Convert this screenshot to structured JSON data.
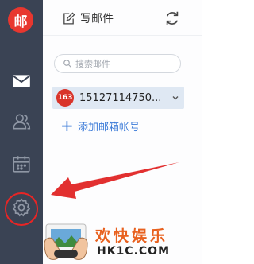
{
  "sidebar": {
    "logo_text": "邮",
    "icons": [
      "mail-icon",
      "contacts-icon",
      "calendar-icon",
      "settings-icon"
    ],
    "accent_color": "#e8372f",
    "background_color": "#3a4354"
  },
  "toolbar": {
    "compose_label": "写邮件",
    "refresh_icon": "refresh-icon"
  },
  "search": {
    "placeholder": "搜索邮件"
  },
  "account": {
    "badge": "163",
    "address": "15127114750...",
    "badge_color": "#d9342a"
  },
  "add_account": {
    "label": "添加邮箱帐号",
    "link_color": "#3c7bd8"
  },
  "watermark": {
    "title": "欢快娱乐",
    "site": "HK1C.COM"
  }
}
